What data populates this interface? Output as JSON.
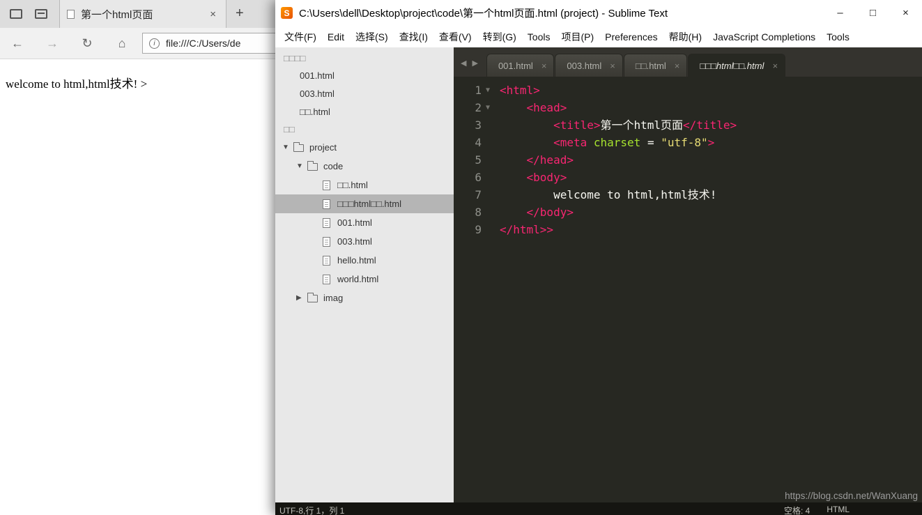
{
  "colors": {
    "monokai_bg": "#272822",
    "tag": "#f92672",
    "attr_name": "#a6e22e",
    "string": "#e6db74",
    "plain_text": "#f8f8f2",
    "sidebar_bg": "#e8e8e8",
    "sidebar_selection_bg": "#b5b5b5",
    "sublime_icon": "#e65100"
  },
  "browser": {
    "tab": {
      "title": "第一个html页面",
      "close_icon": "×"
    },
    "new_tab_icon": "+",
    "nav": {
      "back_icon": "←",
      "forward_icon": "→",
      "refresh_icon": "↻",
      "home_icon": "⌂",
      "info_icon": "i",
      "url": "file:///C:/Users/de"
    },
    "page_text": "welcome to html,html技术! >"
  },
  "sublime": {
    "titlebar": {
      "title": "C:\\Users\\dell\\Desktop\\project\\code\\第一个html页面.html (project) - Sublime Text",
      "app_icon_letter": "S",
      "minimize_icon": "–",
      "maximize_icon": "□",
      "close_icon": "×"
    },
    "menu": [
      "文件(F)",
      "Edit",
      "选择(S)",
      "查找(I)",
      "查看(V)",
      "转到(G)",
      "Tools",
      "项目(P)",
      "Preferences",
      "帮助(H)",
      "JavaScript Completions",
      "Tools"
    ],
    "sidebar": {
      "open_files_header": "□□□□",
      "open_files": [
        "001.html",
        "003.html",
        "□□.html"
      ],
      "folders_header": "□□",
      "tree": [
        {
          "label": "project",
          "type": "folder",
          "indent": 0,
          "state": "open",
          "selected": false
        },
        {
          "label": "code",
          "type": "folder",
          "indent": 1,
          "state": "open",
          "selected": false
        },
        {
          "label": "□□.html",
          "type": "file",
          "indent": 2,
          "selected": false
        },
        {
          "label": "□□□html□□.html",
          "type": "file",
          "indent": 2,
          "selected": true
        },
        {
          "label": "001.html",
          "type": "file",
          "indent": 2,
          "selected": false
        },
        {
          "label": "003.html",
          "type": "file",
          "indent": 2,
          "selected": false
        },
        {
          "label": "hello.html",
          "type": "file",
          "indent": 2,
          "selected": false
        },
        {
          "label": "world.html",
          "type": "file",
          "indent": 2,
          "selected": false
        },
        {
          "label": "imag",
          "type": "folder",
          "indent": 1,
          "state": "closed",
          "selected": false
        }
      ]
    },
    "tab_scroll": {
      "left_icon": "◀",
      "right_icon": "▶"
    },
    "tabs": [
      {
        "label": "001.html",
        "active": false
      },
      {
        "label": "003.html",
        "active": false
      },
      {
        "label": "□□.html",
        "active": false
      },
      {
        "label": "□□□html□□.html",
        "active": true
      }
    ],
    "tab_close_icon": "×",
    "fold_icon": "▼",
    "code_lines": [
      {
        "num": 1,
        "fold": true,
        "tokens": [
          {
            "t": "<html>",
            "c": "tag"
          }
        ]
      },
      {
        "num": 2,
        "fold": true,
        "tokens": [
          {
            "t": "    ",
            "c": "plain"
          },
          {
            "t": "<head>",
            "c": "tag"
          }
        ]
      },
      {
        "num": 3,
        "fold": false,
        "tokens": [
          {
            "t": "        ",
            "c": "plain"
          },
          {
            "t": "<title>",
            "c": "tag"
          },
          {
            "t": "第一个html页面",
            "c": "plain"
          },
          {
            "t": "</title>",
            "c": "tag"
          }
        ]
      },
      {
        "num": 4,
        "fold": false,
        "tokens": [
          {
            "t": "        ",
            "c": "plain"
          },
          {
            "t": "<meta",
            "c": "tag"
          },
          {
            "t": " ",
            "c": "plain"
          },
          {
            "t": "charset",
            "c": "attr"
          },
          {
            "t": " = ",
            "c": "plain"
          },
          {
            "t": "\"utf-8\"",
            "c": "string"
          },
          {
            "t": ">",
            "c": "tag"
          }
        ]
      },
      {
        "num": 5,
        "fold": false,
        "tokens": [
          {
            "t": "    ",
            "c": "plain"
          },
          {
            "t": "</head>",
            "c": "tag"
          }
        ]
      },
      {
        "num": 6,
        "fold": false,
        "tokens": [
          {
            "t": "    ",
            "c": "plain"
          },
          {
            "t": "<body>",
            "c": "tag"
          }
        ]
      },
      {
        "num": 7,
        "fold": false,
        "tokens": [
          {
            "t": "        ",
            "c": "plain"
          },
          {
            "t": "welcome to html,html技术!",
            "c": "plain"
          }
        ]
      },
      {
        "num": 8,
        "fold": false,
        "tokens": [
          {
            "t": "    ",
            "c": "plain"
          },
          {
            "t": "</body>",
            "c": "tag"
          }
        ]
      },
      {
        "num": 9,
        "fold": false,
        "tokens": [
          {
            "t": "</html>>",
            "c": "tag"
          }
        ]
      }
    ],
    "statusbar": {
      "left": "UTF-8,行 1，列 1",
      "spaces": "空格: 4",
      "syntax": "HTML"
    }
  },
  "watermark": "https://blog.csdn.net/WanXuang"
}
